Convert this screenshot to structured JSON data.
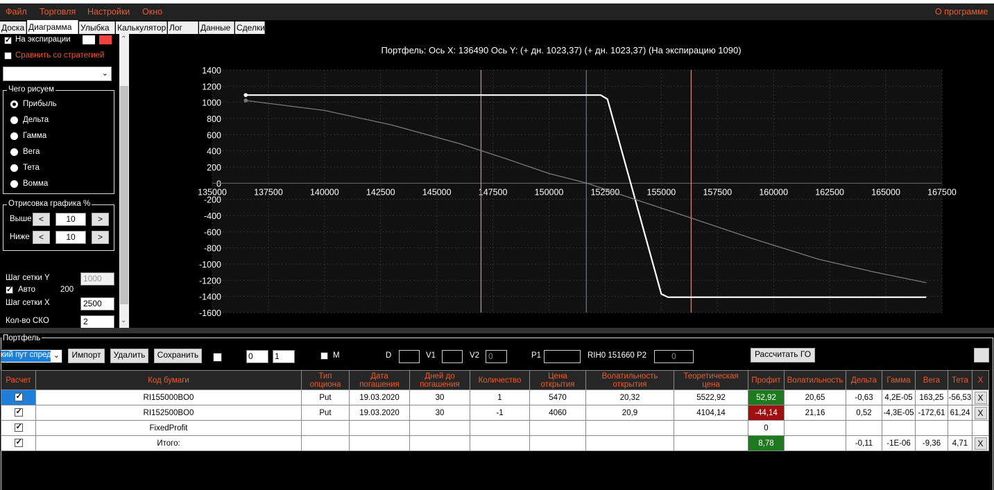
{
  "menu": {
    "file": "Файл",
    "trade": "Торговля",
    "settings": "Настройки",
    "window": "Окно",
    "about": "О программе"
  },
  "tabs": [
    "Доска",
    "Диаграмма",
    "Улыбка",
    "Калькулятор",
    "Лог",
    "Данные",
    "Сделки"
  ],
  "left": {
    "on_expiration": "На экспирации",
    "compare_strategies": "Сравнить со стратегией",
    "draw_group": "Чего рисуем",
    "radios": [
      "Прибыль",
      "Дельта",
      "Гамма",
      "Вега",
      "Тета",
      "Вомма"
    ],
    "render_group": "Отрисовка графика %",
    "above": "Выше",
    "below": "Ниже",
    "above_value": "10",
    "below_value": "10",
    "less": "<",
    "more": ">",
    "grid_y": "Шаг сетки Y",
    "grid_y_value": "1000",
    "auto": "Авто",
    "auto_value": "200",
    "grid_x": "Шаг сетки X",
    "grid_x_value": "2500",
    "sko": "Кол-во СКО",
    "sko_value": "2"
  },
  "chart_data": {
    "type": "line",
    "title": "Портфель:  Ось X:  136490  Ось Y:   (+ дн. 1023,37)   (+ дн. 1023,37)   (На экспирацию  1090)",
    "xlim": [
      135000,
      167500
    ],
    "ylim": [
      -1600,
      1400
    ],
    "x_ticks": [
      "135000",
      "137500",
      "140000",
      "142500",
      "145000",
      "147500",
      "150000",
      "152500",
      "155000",
      "157500",
      "160000",
      "162500",
      "165000",
      "167500"
    ],
    "y_ticks": [
      "1400",
      "1200",
      "1000",
      "800",
      "600",
      "400",
      "200",
      "0",
      "-200",
      "-400",
      "-600",
      "-800",
      "-1000",
      "-1200",
      "-1400",
      "-1600"
    ],
    "vlines_pink": [
      146970,
      156330
    ],
    "vline_blue": 151660,
    "series": [
      {
        "color": "#ffffff",
        "x": [
          136490,
          152300,
          152600,
          155000,
          155300,
          166800
        ],
        "y": [
          1090,
          1090,
          1040,
          -1370,
          -1410,
          -1410
        ]
      },
      {
        "color": "#7a7a7a",
        "x": [
          136490,
          140000,
          143000,
          146000,
          148000,
          150000,
          151700,
          153500,
          156000,
          159000,
          162000,
          164500,
          166800
        ],
        "y": [
          1023,
          900,
          720,
          490,
          310,
          120,
          0,
          -170,
          -400,
          -680,
          -940,
          -1100,
          -1230
        ]
      }
    ]
  },
  "portfolio": {
    "title": "Портфель",
    "strategy_select": "кий пут спред",
    "import": "Импорт",
    "delete": "Удалить",
    "save": "Сохранить",
    "spin1": "0",
    "spin2": "1",
    "m_label": "M",
    "d_label": "D",
    "v1_label": "V1",
    "v2_label": "V2",
    "v2_value": "0",
    "p1_label": "P1",
    "ticker": "RIH0 151660",
    "p2_label": "P2",
    "p2_value": "0",
    "calc_go": "Рассчитать ГО",
    "headers": [
      "Расчет",
      "Код бумаги",
      "Тип\nопциона",
      "Дата\nпогашения",
      "Дней до\nпогашения",
      "Количество",
      "Цена\nоткрытия",
      "Волатильность\nоткрытия",
      "Теоретическая\nцена",
      "Профит",
      "Волатильность",
      "Дельта",
      "Гамма",
      "Вега",
      "Тета",
      "X"
    ],
    "rows": [
      [
        "",
        "RI155000BO0",
        "Put",
        "19.03.2020",
        "30",
        "1",
        "5470",
        "20,32",
        "5522,92",
        "52,92",
        "20,65",
        "-0,63",
        "4,2E-05",
        "163,25",
        "-56,53",
        "X"
      ],
      [
        "",
        "RI152500BO0",
        "Put",
        "19.03.2020",
        "30",
        "-1",
        "4060",
        "20,9",
        "4104,14",
        "-44,14",
        "21,16",
        "0,52",
        "-4,3E-05",
        "-172,61",
        "61,24",
        "X"
      ],
      [
        "",
        "FixedProfit",
        "",
        "",
        "",
        "",
        "",
        "",
        "",
        "0",
        "",
        "",
        "",
        "",
        "",
        ""
      ],
      [
        "",
        "Итого:",
        "",
        "",
        "",
        "",
        "",
        "",
        "",
        "8,78",
        "",
        "-0,11",
        "-1E-06",
        "-9,36",
        "4,71",
        "X"
      ]
    ],
    "profit_colors": [
      "green",
      "red",
      "",
      "green"
    ]
  }
}
